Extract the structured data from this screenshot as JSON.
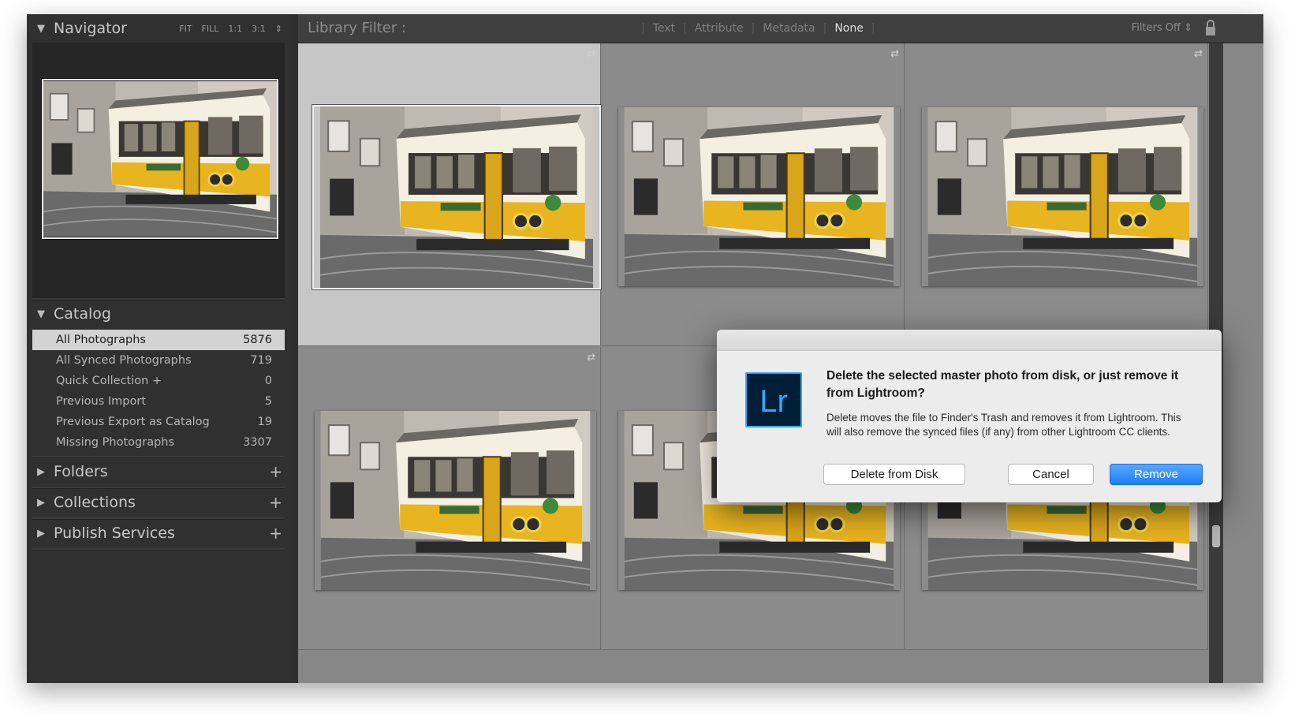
{
  "navigator": {
    "title": "Navigator",
    "zoom_options": [
      "FIT",
      "FILL",
      "1:1",
      "3:1"
    ]
  },
  "catalog": {
    "title": "Catalog",
    "items": [
      {
        "label": "All Photographs",
        "count": "5876"
      },
      {
        "label": "All Synced Photographs",
        "count": "719"
      },
      {
        "label": "Quick Collection +",
        "count": "0"
      },
      {
        "label": "Previous Import",
        "count": "5"
      },
      {
        "label": "Previous Export as Catalog",
        "count": "19"
      },
      {
        "label": "Missing Photographs",
        "count": "3307"
      }
    ]
  },
  "panels": {
    "folders": "Folders",
    "collections": "Collections",
    "publish_services": "Publish Services"
  },
  "library_filter": {
    "title": "Library Filter :",
    "options": [
      "Text",
      "Attribute",
      "Metadata",
      "None"
    ],
    "active": "None",
    "filters_state": "Filters Off"
  },
  "dialog": {
    "logo": "Lr",
    "heading": "Delete the selected master photo from disk, or just remove it from Lightroom?",
    "body": "Delete moves the file to Finder's Trash and removes it from Lightroom.  This will also remove the synced files (if any) from other Lightroom CC clients.",
    "buttons": {
      "delete": "Delete from Disk",
      "cancel": "Cancel",
      "remove": "Remove"
    }
  },
  "colors": {
    "lr_blue": "#31a8ff",
    "primary_button": "#1c7ef6",
    "selected_cell": "#c6c6c6"
  },
  "icons": [
    "disclosure-triangle",
    "plus-icon",
    "lock-icon",
    "sync-badge-icon",
    "tram-photo"
  ]
}
